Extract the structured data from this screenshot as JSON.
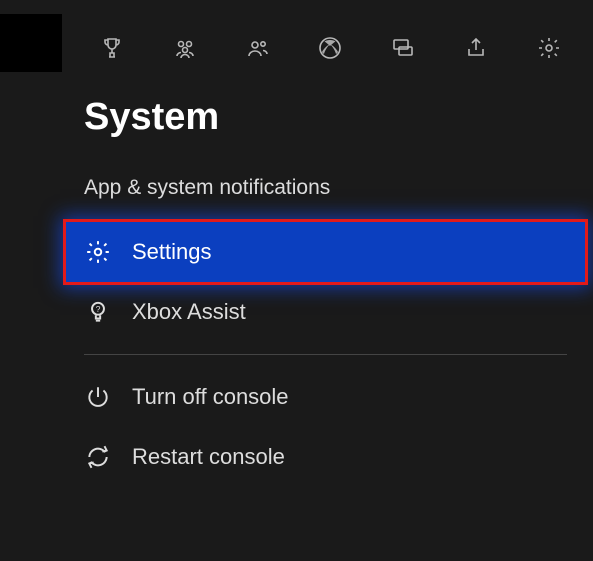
{
  "toolbar": {
    "icons": [
      "achievements-icon",
      "friends-icon",
      "party-icon",
      "xbox-icon",
      "chat-icon",
      "share-icon",
      "settings-icon"
    ]
  },
  "title": "System",
  "menu": {
    "notifications_label": "App & system notifications",
    "settings_label": "Settings",
    "xbox_assist_label": "Xbox Assist",
    "turn_off_label": "Turn off console",
    "restart_label": "Restart console"
  },
  "colors": {
    "selected_bg": "#0b3fbf",
    "highlight_outline": "#e21a1a",
    "background": "#1a1a1a"
  }
}
